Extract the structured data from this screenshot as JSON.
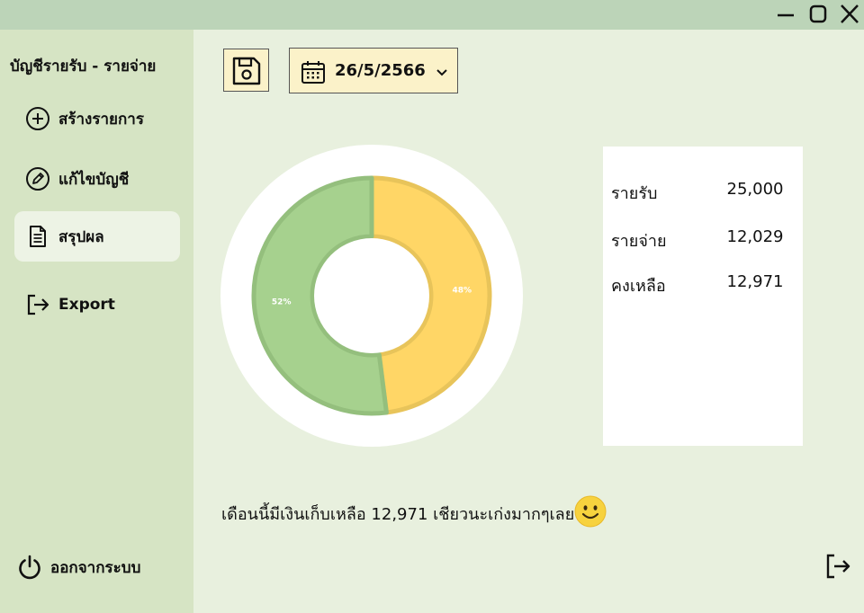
{
  "window": {
    "minimize_icon": "minimize-icon",
    "maximize_icon": "maximize-icon",
    "close_icon": "close-icon"
  },
  "sidebar": {
    "app_title": "บัญชีรายรับ - รายจ่าย",
    "items": [
      {
        "label": "สร้างรายการ",
        "icon": "plus-circle-icon",
        "active": false
      },
      {
        "label": "แก้ไขบัญชี",
        "icon": "pencil-circle-icon",
        "active": false
      },
      {
        "label": "สรุปผล",
        "icon": "document-icon",
        "active": true
      },
      {
        "label": "Export",
        "icon": "export-icon",
        "active": false
      }
    ],
    "logout_label": "ออกจากระบบ",
    "logout_icon": "power-icon"
  },
  "toolbar": {
    "save_icon": "floppy-disk-icon",
    "date_value": "26/5/2566",
    "calendar_icon": "calendar-icon",
    "dropdown_icon": "chevron-down-icon"
  },
  "chart_data": {
    "type": "pie",
    "slices": [
      {
        "value": 48,
        "label": "48%",
        "color": "#ffd666",
        "stroke": "#e8c45a"
      },
      {
        "value": 52,
        "label": "52%",
        "color": "#a6d18e",
        "stroke": "#94bf7d"
      }
    ]
  },
  "summary": {
    "rows": [
      {
        "label": "รายรับ",
        "value": "25,000"
      },
      {
        "label": "รายจ่าย",
        "value": "12,029"
      },
      {
        "label": "คงเหลือ",
        "value": "12,971"
      }
    ]
  },
  "message": {
    "text": "เดือนนี้มีเงินเก็บเหลือ 12,971 เชียวนะเก่งมากๆเลย",
    "emoji_icon": "smiley-face-icon"
  },
  "footer": {
    "exit_icon": "exit-icon"
  }
}
